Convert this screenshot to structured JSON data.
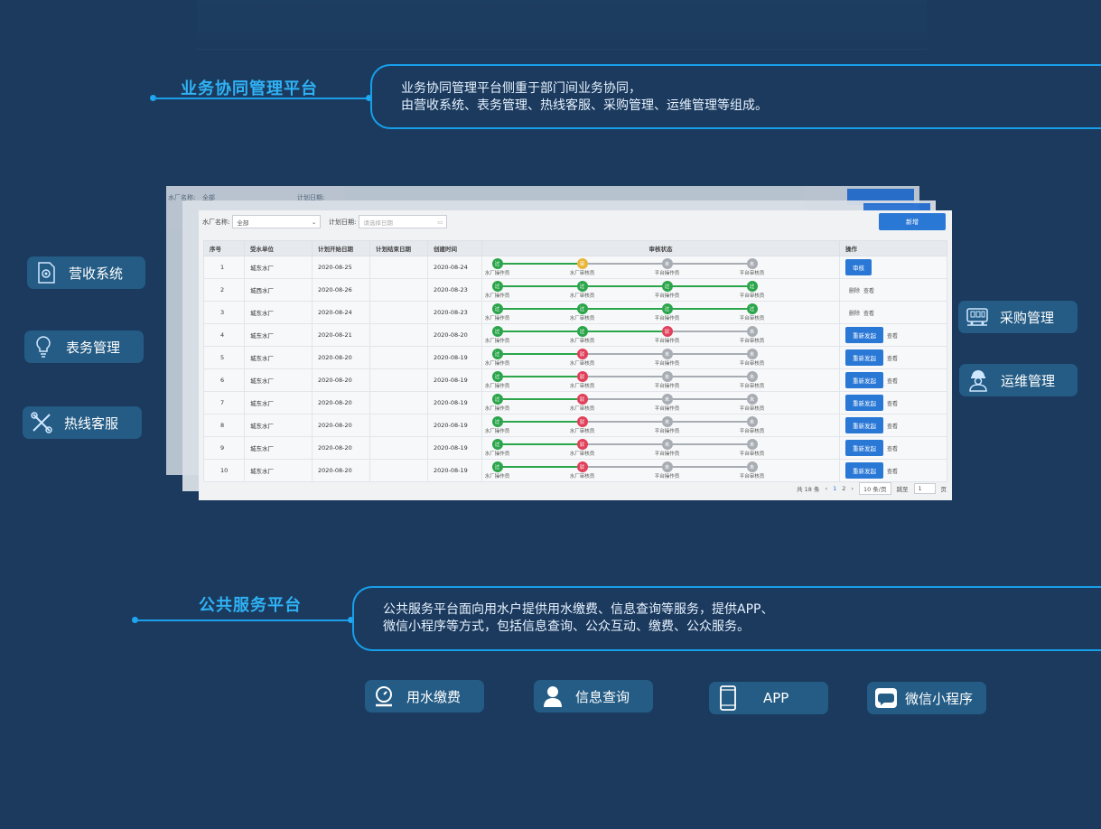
{
  "business": {
    "title": "业务协同管理平台",
    "desc_line1": "业务协同管理平台侧重于部门间业务协同，",
    "desc_line2": "由营收系统、表务管理、热线客服、采购管理、运维管理等组成。"
  },
  "left_modules": [
    {
      "label": "营收系统",
      "icon": "settings-document-icon"
    },
    {
      "label": "表务管理",
      "icon": "lightbulb-icon"
    },
    {
      "label": "热线客服",
      "icon": "tools-icon"
    }
  ],
  "right_modules": [
    {
      "label": "采购管理",
      "icon": "train-icon"
    },
    {
      "label": "运维管理",
      "icon": "engineer-icon"
    }
  ],
  "table_panel": {
    "filter_plant_label": "水厂名称:",
    "filter_plant_value": "全部",
    "filter_date_label": "计划日期:",
    "filter_date_placeholder": "请选择日期",
    "add_button": "新增",
    "headers": [
      "序号",
      "受水单位",
      "计划开始日期",
      "计划结束日期",
      "创建时间",
      "审核状态",
      "操作"
    ],
    "step_labels": [
      "水厂操作员",
      "水厂审核员",
      "平台操作员",
      "平台审核员"
    ],
    "rows": [
      {
        "no": "1",
        "unit": "城东水厂",
        "start": "2020-08-25",
        "end": "",
        "created": "2020-08-24",
        "steps": [
          "过",
          "审",
          "未",
          "未"
        ],
        "action": "审核"
      },
      {
        "no": "2",
        "unit": "城西水厂",
        "start": "2020-08-26",
        "end": "",
        "created": "2020-08-23",
        "steps": [
          "过",
          "过",
          "过",
          "过"
        ],
        "action": "删除查看"
      },
      {
        "no": "3",
        "unit": "城东水厂",
        "start": "2020-08-24",
        "end": "",
        "created": "2020-08-23",
        "steps": [
          "过",
          "过",
          "过",
          "过"
        ],
        "action": "删除查看"
      },
      {
        "no": "4",
        "unit": "城东水厂",
        "start": "2020-08-21",
        "end": "",
        "created": "2020-08-20",
        "steps": [
          "过",
          "过",
          "驳",
          "未"
        ],
        "action": "重新发起"
      },
      {
        "no": "5",
        "unit": "城东水厂",
        "start": "2020-08-20",
        "end": "",
        "created": "2020-08-19",
        "steps": [
          "过",
          "驳",
          "未",
          "未"
        ],
        "action": "重新发起"
      },
      {
        "no": "6",
        "unit": "城东水厂",
        "start": "2020-08-20",
        "end": "",
        "created": "2020-08-19",
        "steps": [
          "过",
          "驳",
          "未",
          "未"
        ],
        "action": "重新发起"
      },
      {
        "no": "7",
        "unit": "城东水厂",
        "start": "2020-08-20",
        "end": "",
        "created": "2020-08-19",
        "steps": [
          "过",
          "驳",
          "未",
          "未"
        ],
        "action": "重新发起"
      },
      {
        "no": "8",
        "unit": "城东水厂",
        "start": "2020-08-20",
        "end": "",
        "created": "2020-08-19",
        "steps": [
          "过",
          "驳",
          "未",
          "未"
        ],
        "action": "重新发起"
      },
      {
        "no": "9",
        "unit": "城东水厂",
        "start": "2020-08-20",
        "end": "",
        "created": "2020-08-19",
        "steps": [
          "过",
          "驳",
          "未",
          "未"
        ],
        "action": "重新发起"
      },
      {
        "no": "10",
        "unit": "城东水厂",
        "start": "2020-08-20",
        "end": "",
        "created": "2020-08-19",
        "steps": [
          "过",
          "驳",
          "未",
          "未"
        ],
        "action": "重新发起"
      }
    ],
    "delete_label": "删除",
    "view_label": "查看",
    "pager_total": "共 18 条",
    "pager_pages": [
      "1",
      "2"
    ],
    "pager_size": "10 条/页",
    "pager_goto": "跳至",
    "pager_goto_value": "1",
    "pager_page_unit": "页"
  },
  "public": {
    "title": "公共服务平台",
    "desc_line1": "公共服务平台面向用水户提供用水缴费、信息查询等服务，提供APP、",
    "desc_line2": "微信小程序等方式，包括信息查询、公众互动、缴费、公众服务。"
  },
  "bottom_modules": [
    {
      "label": "用水缴费",
      "icon": "water-meter-icon"
    },
    {
      "label": "信息查询",
      "icon": "user-icon"
    },
    {
      "label": "APP",
      "icon": "phone-icon"
    },
    {
      "label": "微信小程序",
      "icon": "chat-icon"
    }
  ],
  "colors": {
    "background": "#1b3a5e",
    "accent": "#1d9ee8",
    "chip": "#245c85",
    "pass": "#2aa54a",
    "reject": "#e0405a",
    "pending": "#e8b63a",
    "inactive": "#a8adb4"
  }
}
